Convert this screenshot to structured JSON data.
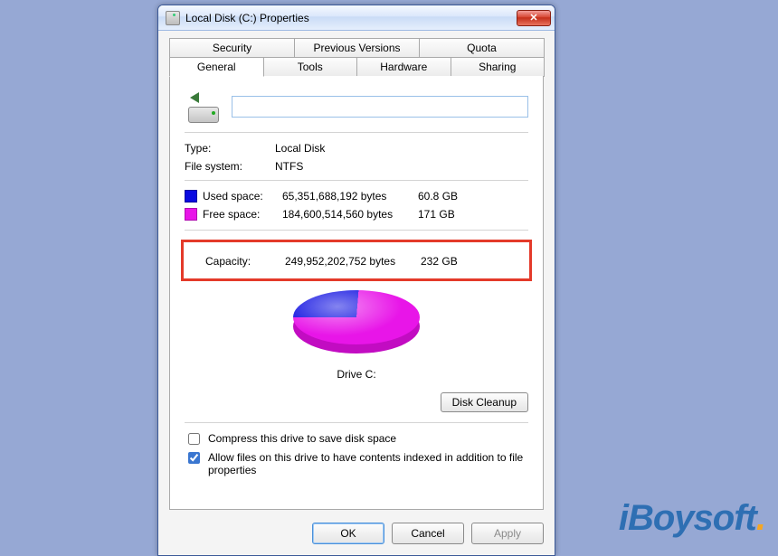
{
  "window": {
    "title": "Local Disk (C:) Properties"
  },
  "tabs": {
    "row1": [
      "Security",
      "Previous Versions",
      "Quota"
    ],
    "row2": [
      "General",
      "Tools",
      "Hardware",
      "Sharing"
    ],
    "active": "General"
  },
  "drive": {
    "name_value": "",
    "type_label": "Type:",
    "type_value": "Local Disk",
    "fs_label": "File system:",
    "fs_value": "NTFS"
  },
  "space": {
    "used_label": "Used space:",
    "used_bytes": "65,351,688,192 bytes",
    "used_human": "60.8 GB",
    "free_label": "Free space:",
    "free_bytes": "184,600,514,560 bytes",
    "free_human": "171 GB",
    "capacity_label": "Capacity:",
    "capacity_bytes": "249,952,202,752 bytes",
    "capacity_human": "232 GB"
  },
  "drive_label": "Drive C:",
  "buttons": {
    "disk_cleanup": "Disk Cleanup",
    "ok": "OK",
    "cancel": "Cancel",
    "apply": "Apply"
  },
  "checkboxes": {
    "compress_label": "Compress this drive to save disk space",
    "compress_checked": false,
    "index_label": "Allow files on this drive to have contents indexed in addition to file properties",
    "index_checked": true
  },
  "watermark": "iBoysoft",
  "chart_data": {
    "type": "pie",
    "title": "Drive C:",
    "series": [
      {
        "name": "Used space",
        "value": 65351688192,
        "human": "60.8 GB",
        "color": "#0a0ae0"
      },
      {
        "name": "Free space",
        "value": 184600514560,
        "human": "171 GB",
        "color": "#e815e8"
      }
    ],
    "total": {
      "name": "Capacity",
      "value": 249952202752,
      "human": "232 GB"
    }
  }
}
